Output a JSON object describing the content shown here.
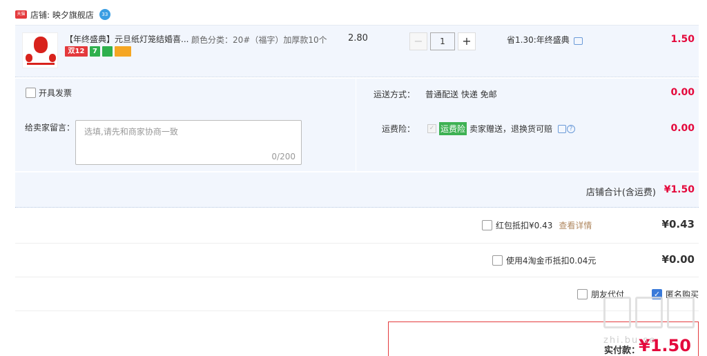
{
  "shop": {
    "tmall_badge": "天猫",
    "label": "店铺: 映夕旗舰店",
    "wangwang_badge": "33"
  },
  "item": {
    "title": "【年终盛典】元旦纸灯笼结婚喜...",
    "promos": [
      "双12",
      "7",
      "",
      ""
    ],
    "sku": "颜色分类：20#（福字）加厚款10个",
    "unit_price": "2.80",
    "qty": "1",
    "qty_minus": "−",
    "qty_plus": "+",
    "saving": "省1.30:年终盛典",
    "total": "1.50"
  },
  "options": {
    "invoice_label": "开具发票",
    "message_label": "给卖家留言：",
    "message_placeholder": "选填,请先和商家协商一致",
    "message_count": "0/200",
    "shipping_label": "运送方式：",
    "shipping_value": "普通配送 快递 免邮",
    "shipping_fee": "0.00",
    "insurance_label": "运费险：",
    "insurance_tag": "运费险",
    "insurance_text": "卖家赠送，退换货可赔",
    "insurance_fee": "0.00"
  },
  "subtotal": {
    "label": "店铺合计(含运费)",
    "value": "¥1.50"
  },
  "discounts": {
    "redpacket_label": "红包抵扣¥0.43",
    "redpacket_link": "查看详情",
    "redpacket_amount": "¥0.43",
    "coins_label": "使用4淘金币抵扣0.04元",
    "coins_amount": "¥0.00",
    "friend_pay": "朋友代付",
    "anonymous": "匿名购买"
  },
  "payment": {
    "label": "实付款：",
    "value": "¥1.50"
  },
  "watermark": {
    "text": "值值值",
    "sub": "zhi.bu.se"
  },
  "colors": {
    "price_red": "#e4093c",
    "panel_bg": "#f2f6fd",
    "accent_blue": "#3a7ad9"
  }
}
